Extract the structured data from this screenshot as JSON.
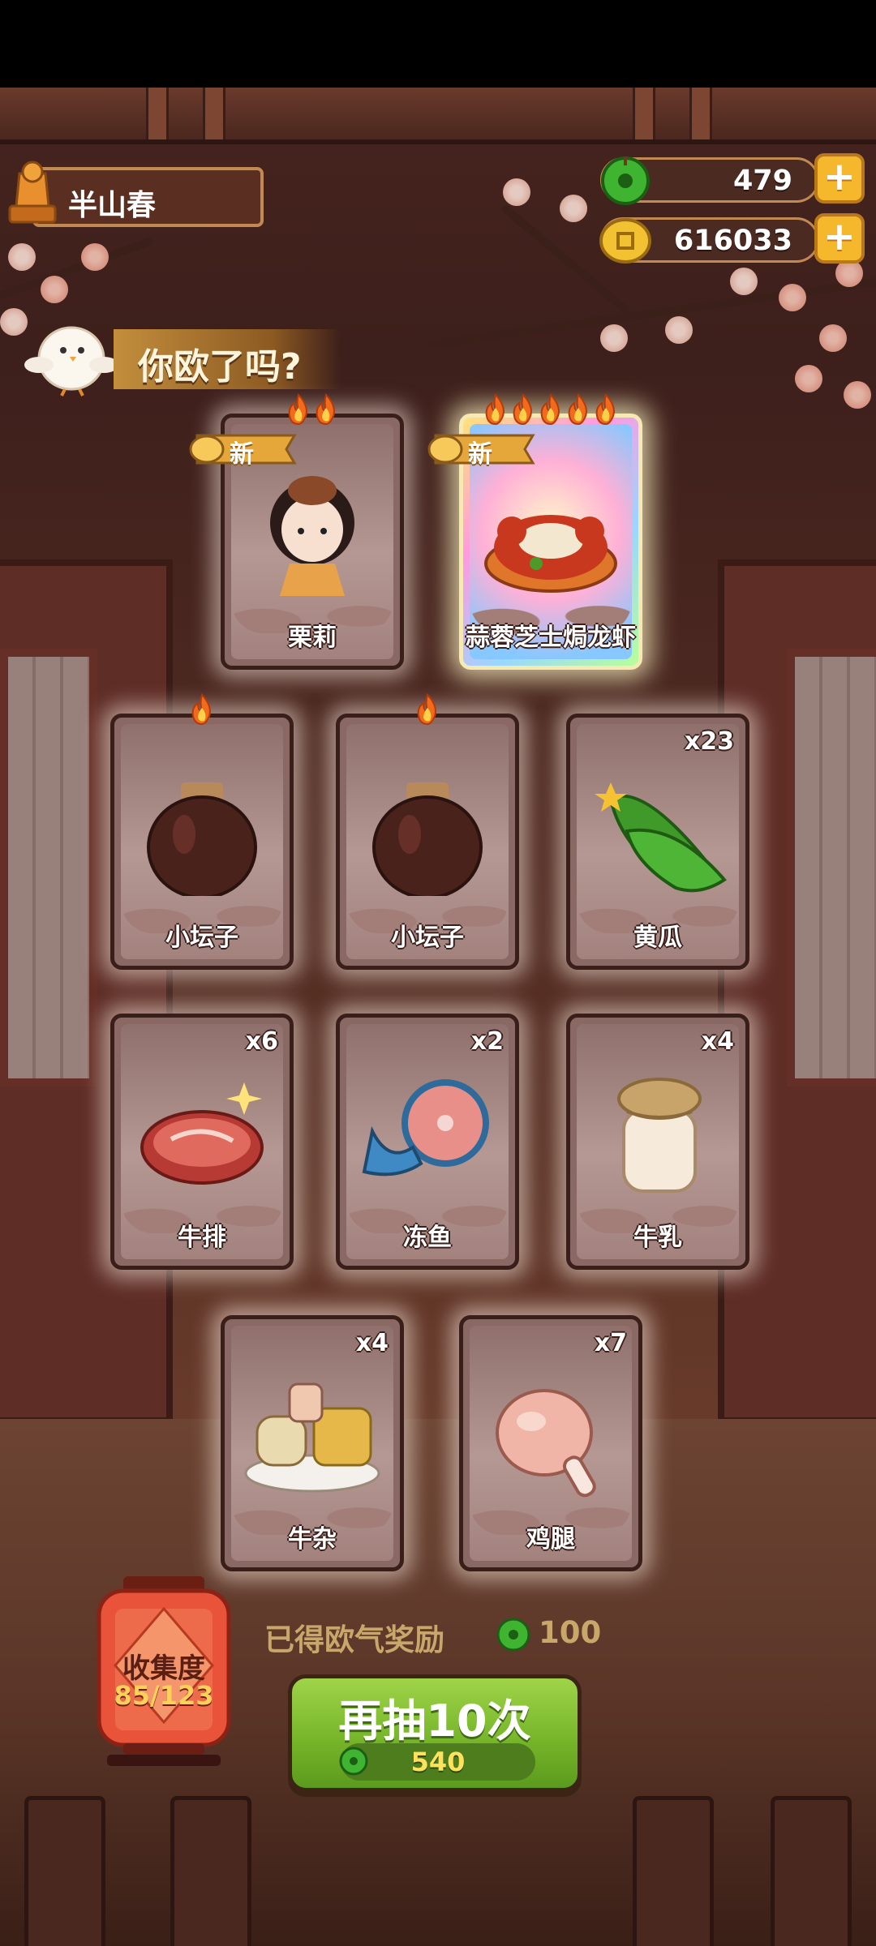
{
  "player": {
    "name": "半山春"
  },
  "currency": {
    "jade": {
      "value": "479",
      "icon": "green-jade-coin-icon"
    },
    "coins": {
      "value": "616033",
      "icon": "gold-coin-icon"
    },
    "plus_label": "+"
  },
  "banner": {
    "text": "你欧了吗?"
  },
  "new_label": "新",
  "cards": [
    {
      "label": "栗莉",
      "count": "",
      "flames": 2,
      "is_new": true,
      "rarity": "character",
      "icon": "girl-chef-character-icon"
    },
    {
      "label": "蒜蓉芝士焗龙虾",
      "count": "",
      "flames": 5,
      "is_new": true,
      "rarity": "rainbow",
      "icon": "garlic-cheese-lobster-dish-icon"
    },
    {
      "label": "小坛子",
      "count": "",
      "flames": 1,
      "is_new": false,
      "icon": "small-jar-icon"
    },
    {
      "label": "小坛子",
      "count": "",
      "flames": 1,
      "is_new": false,
      "icon": "small-jar-icon"
    },
    {
      "label": "黄瓜",
      "count": "x23",
      "flames": 0,
      "is_new": false,
      "icon": "cucumber-icon"
    },
    {
      "label": "牛排",
      "count": "x6",
      "flames": 0,
      "is_new": false,
      "icon": "steak-icon"
    },
    {
      "label": "冻鱼",
      "count": "x2",
      "flames": 0,
      "is_new": false,
      "icon": "frozen-fish-icon"
    },
    {
      "label": "牛乳",
      "count": "x4",
      "flames": 0,
      "is_new": false,
      "icon": "milk-jar-icon"
    },
    {
      "label": "牛杂",
      "count": "x4",
      "flames": 0,
      "is_new": false,
      "icon": "beef-offal-icon"
    },
    {
      "label": "鸡腿",
      "count": "x7",
      "flames": 0,
      "is_new": false,
      "icon": "chicken-leg-icon"
    }
  ],
  "collection": {
    "title": "收集度",
    "progress": "85/123"
  },
  "luck_bonus": {
    "text": "已得欧气奖励",
    "value": "100",
    "icon": "green-jade-coin-icon"
  },
  "draw_button": {
    "label": "再抽10次",
    "cost": "540",
    "icon": "green-jade-coin-icon"
  },
  "colors": {
    "accent_green": "#74b328",
    "gold": "#f5b82d",
    "text_gold": "#c9a76a",
    "wood": "#4a271f"
  }
}
